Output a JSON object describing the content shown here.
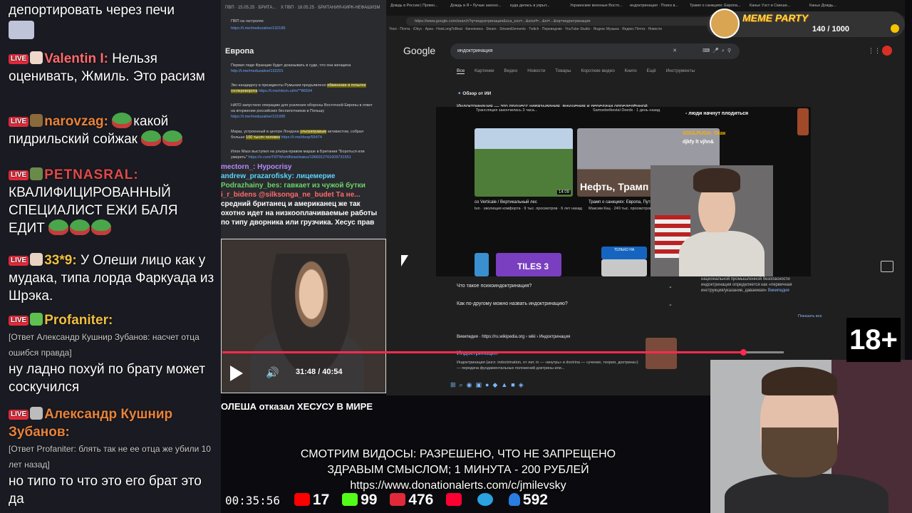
{
  "chat": {
    "messages": [
      {
        "nick": "",
        "text": "депортировать через печи"
      },
      {
        "nick": "Valentin I:",
        "nick_color": "#ff6b6b",
        "text": "Нельзя оценивать, Жмиль. Это расизм"
      },
      {
        "nick": "narovzag:",
        "nick_color": "#e8833a",
        "text": "какой пидрильский сойжак"
      },
      {
        "nick": "PETNASRAL:",
        "nick_color": "#e04a4a",
        "text": "КВАЛИФИЦИРОВАННЫЙ СПЕЦИАЛИСТ ЕЖИ БАЛЯ ЕДИТ"
      },
      {
        "nick": "33*9:",
        "nick_color": "#f0c040",
        "text": "У Олеши лицо как у мудака, типа лорда Фаркуада из Шрэка."
      },
      {
        "nick": "Profaniter:",
        "nick_color": "#f0c040",
        "reply": "[Ответ Александр Кушнир Зубанов: насчет отца ошибся правда]",
        "text": "ну ладно похуй по брату может соскучился"
      },
      {
        "nick": "Александр Кушнир Зубанов:",
        "nick_color": "#e8833a",
        "reply": "[Ответ Profaniter: блять так не ее отца же убили 10 лет назад]",
        "text": "но типо то что это его брат это да"
      }
    ],
    "badge_label": "LIVE"
  },
  "left_window": {
    "tabs": [
      "ПВП · 15.05.25 · БРИТА...",
      "X ПВП · 18.05.25 · БРИТАНИЯ-КИРК-НЕФАШИЗМ"
    ],
    "header_line": "ПВП на гастролях",
    "header_link": "https://t.me/meduzalive/132189",
    "section": "Европа",
    "items": [
      {
        "text": "Первая леди Франции будет доказывать в суде, что она женщина",
        "link": "http://t.me/meduzalive/132201"
      },
      {
        "text": "Экс-кандидату в президенты Румынии предъявлено",
        "highlight": "обвинение в попытке госпереворота",
        "link": "https://t.me/nbcm.ui/m/**86594"
      },
      {
        "text": "НАТО запустило операцию для усиления обороны Восточной Европы в ответ на вторжение российских беспилотников в Польшу",
        "link": "https://t.me/meduzalive/131995"
      },
      {
        "text": "Марш, устроенный в центре Лондона",
        "highlight": "ультраправым",
        "text2": "активистом, собрал больше",
        "highlight2": "100 тысяч человек",
        "link": "https://t.me/dsnp/55474"
      },
      {
        "text": "Илон Маск выступил на ультра-правом марше в Британии \"Бороться или умереть\"",
        "link": "https://x.com/TRTWorldNow/status/1966912761609731551"
      }
    ],
    "overlay_chat": [
      {
        "text": "mectorn_: Hypocrisy",
        "color": "#b98aff"
      },
      {
        "text": "andrew_prazarofisky: лицемерие",
        "color": "#5bd4ff"
      },
      {
        "text": "Podrazhainy_bes: гавкает из чужой бутки",
        "color": "#6bd36b"
      },
      {
        "text": "i_r_bidens @silksonga_ne_budet Та не...",
        "color": "#ff6a6a"
      },
      {
        "text": "средний британец и американец же так",
        "color": "#ffffff"
      },
      {
        "text": "охотно идет на низкооплачиваемые работы",
        "color": "#ffffff"
      },
      {
        "text": "по типу дворника или грузчика. Хесус прав",
        "color": "#ffffff"
      }
    ]
  },
  "player": {
    "time": "31:48 / 40:54",
    "progress": 0.778,
    "video_title": "ОЛЕША отказал ХЕСУСУ В МИРЕ"
  },
  "browser": {
    "tabs": [
      "Дождь в России | Прямо...",
      "Дождь в Я • Лучше законо...",
      "куда делась в укрыт...",
      "Украинские военные Восто...",
      "индоктринация · Поиск в...",
      "Трамп о санкциях: Европа...",
      "Канье Уэст в Смеши...",
      "Канье Дождь..."
    ],
    "url": "https://www.google.com/search?q=индоктринация&sca_esv=...&sxsrf=...&ei=...&oq=индоктринация",
    "bookmarks": "Yoox · Почта · iOkyc · Арка · HowLongToBeat · Кинопоиск · Steam · StreamElements · Twitch · Переводчик · YouTube Studio · Яндекс Музыка · Яндекс Почта · Новости",
    "google_logo": "Google",
    "search_query": "индоктринация",
    "search_tabs": [
      "Все",
      "Картинки",
      "Видео",
      "Новости",
      "Товары",
      "Короткие видео",
      "Книги",
      "Ещё",
      "Инструменты"
    ],
    "ai_overview": "Обзор от ИИ",
    "ai_text": "Индоктринация — это процесс навязывания, внушения и передачи определённой",
    "faq": [
      "Что такое психоиндоктринация?",
      "Как по-другому можно назвать индоктринацию?"
    ],
    "wiki_head": "Википедия · https://ru.wikipedia.org › wiki › Индоктринация",
    "wiki_title": "Индоктринация",
    "wiki_desc": "Индоктринация (англ. indoctrination, от лат. in — «внутрь» и doctrina — «учение, теория, доктрина») — передача фундаментальных положений доктрины или...",
    "side_text": "национальной промышленной безопасности индоктринация определяется как «первичная инструкция/указание, даваемая»",
    "side_link": "Википедия",
    "side_show_more": "Показать все"
  },
  "yt": {
    "card1_title": "Вертикальный лес",
    "card1_caption": "co Verticale / Вертикальный лес",
    "card1_meta": "tun · эволюция комфорта · 9 тыс. просмотров · 6 лет назад",
    "card1_duration": "14:09",
    "card2_overlay": "Нефть, Трамп",
    "card2_caption": "Трамп о санкциях: Европа, Путину деньги (English subt",
    "card2_meta": "Максим Кац · 249 тыс. просмотров · 8 часов",
    "top_caption": "Трансляция закончилась 3 часа...",
    "top_caption2": "Samsebelkestal Deeds · 1 день назад",
    "chat_lines": [
      "- люди начнут плодиться",
      "SOULPUGA: Окак",
      "djkfy lt vjhn&"
    ],
    "tiles_label": "TILES 3",
    "now_label": "ТОЛЬКО НА"
  },
  "caption": {
    "line1": "СМОТРИМ ВИДОСЫ: РАЗРЕШЕНО, ЧТО НЕ ЗАПРЕЩЕНО",
    "line2": "ЗДРАВЫМ СМЫСЛОМ; 1 МИНУТА - 200 РУБЛЕЙ",
    "line3": "https://www.donationalerts.com/c/jmilevsky"
  },
  "rating": "18+",
  "meme_party": {
    "title": "MEME PARTY",
    "count": "140 / 1000"
  },
  "status_bar": {
    "timer": "00:35:56",
    "youtube": "17",
    "kick": "99",
    "live": "476",
    "telegram_label": "",
    "viewers": "592"
  }
}
